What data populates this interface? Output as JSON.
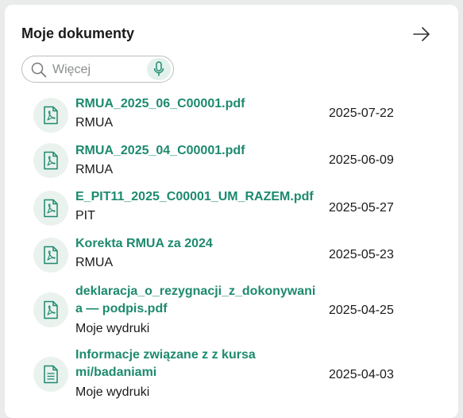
{
  "widget": {
    "title": "Moje dokumenty",
    "search_placeholder": "Więcej",
    "search_value": ""
  },
  "documents": [
    {
      "name": "RMUA_2025_06_C00001.pdf",
      "category": "RMUA",
      "date": "2025-07-22",
      "icon": "pdf-file-icon"
    },
    {
      "name": "RMUA_2025_04_C00001.pdf",
      "category": "RMUA",
      "date": "2025-06-09",
      "icon": "pdf-file-icon"
    },
    {
      "name": "E_PIT11_2025_C00001_UM_RAZEM.pdf",
      "category": "PIT",
      "date": "2025-05-27",
      "icon": "pdf-file-icon"
    },
    {
      "name": "Korekta RMUA za 2024",
      "category": "RMUA",
      "date": "2025-05-23",
      "icon": "pdf-file-icon"
    },
    {
      "name": "deklaracja_o_rezygnacji_z_dokonywania — podpis.pdf",
      "category": "Moje wydruki",
      "date": "2025-04-25",
      "icon": "pdf-file-icon"
    },
    {
      "name": "Informacje związane z z kursami/badaniami",
      "category": "Moje wydruki",
      "date": "2025-04-03",
      "icon": "text-file-icon"
    }
  ],
  "colors": {
    "accent": "#1d8a6e",
    "icon_bg": "#eaf2ee",
    "mic_bg": "#e3f1ec"
  }
}
